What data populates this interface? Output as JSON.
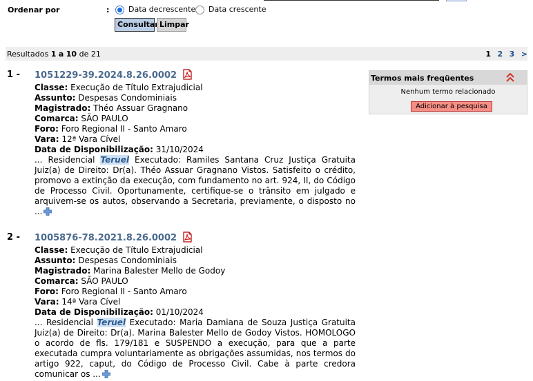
{
  "form": {
    "order_label": "Ordenar por",
    "order_colon": ":",
    "option_desc": "Data decrescente",
    "option_asc": "Data crescente",
    "consultar_label": "Consultar",
    "limpar_label": "Limpar"
  },
  "results": {
    "prefix": "Resultados",
    "range_from": "1",
    "range_sep": "a",
    "range_to": "10",
    "of": "de",
    "total": "21",
    "pages": [
      "1",
      "2",
      "3"
    ],
    "next": ">"
  },
  "items": [
    {
      "num": "1 -",
      "process": "1051229-39.2024.8.26.0002",
      "classe_label": "Classe:",
      "classe": "Execução de Título Extrajudicial",
      "assunto_label": "Assunto:",
      "assunto": "Despesas Condominiais",
      "magistrado_label": "Magistrado:",
      "magistrado": "Théo Assuar Gragnano",
      "comarca_label": "Comarca:",
      "comarca": "SÃO PAULO",
      "foro_label": "Foro:",
      "foro": "Foro Regional II - Santo Amaro",
      "vara_label": "Vara:",
      "vara": "12ª Vara Cível",
      "data_label": "Data de Disponibilização:",
      "data": "31/10/2024",
      "snippet_pre": "... Residencial ",
      "highlight": "Teruel",
      "snippet_post": " Executado: Ramiles Santana Cruz Justiça Gratuita Juiz(a) de Direito: Dr(a). Théo Assuar Gragnano Vistos. Satisfeito o crédito, promovo a extinção da execução, com fundamento no art. 924, II, do Código de Processo Civil. Oportunamente, certifique-se o trânsito em julgado e arquivem-se os autos, observando a Secretaria, previamente, o disposto no ..."
    },
    {
      "num": "2 -",
      "process": "1005876-78.2021.8.26.0002",
      "classe_label": "Classe:",
      "classe": "Execução de Título Extrajudicial",
      "assunto_label": "Assunto:",
      "assunto": "Despesas Condominiais",
      "magistrado_label": "Magistrado:",
      "magistrado": "Marina Balester Mello de Godoy",
      "comarca_label": "Comarca:",
      "comarca": "SÃO PAULO",
      "foro_label": "Foro:",
      "foro": "Foro Regional II - Santo Amaro",
      "vara_label": "Vara:",
      "vara": "14ª Vara Cível",
      "data_label": "Data de Disponibilização:",
      "data": "01/10/2024",
      "snippet_pre": "... Residencial ",
      "highlight": "Teruel",
      "snippet_post": " Executado: Maria Damiana de Souza Justiça Gratuita Juiz(a) de Direito: Dr(a). Marina Balester Mello de Godoy Vistos. HOMOLOGO o acordo de fls. 179/181 e SUSPENDO a execução, para que a parte executada cumpra voluntariamente as obrigações assumidas, nos termos do artigo 922, caput, do Código de Processo Civil. Cabe à parte credora comunicar os ..."
    }
  ],
  "terms": {
    "title": "Termos mais freqüentes",
    "none": "Nenhum termo relacionado",
    "add": "Adicionar à pesquisa"
  },
  "icons": {
    "pdf": "pdf-icon",
    "expand": "plus-icon",
    "collapse": "double-chevron-up-icon"
  },
  "colors": {
    "link": "#4a6a8e",
    "highlight_bg": "#cfe1f5",
    "add_button": "#f58e84",
    "consultar_button": "#b9cde6"
  }
}
